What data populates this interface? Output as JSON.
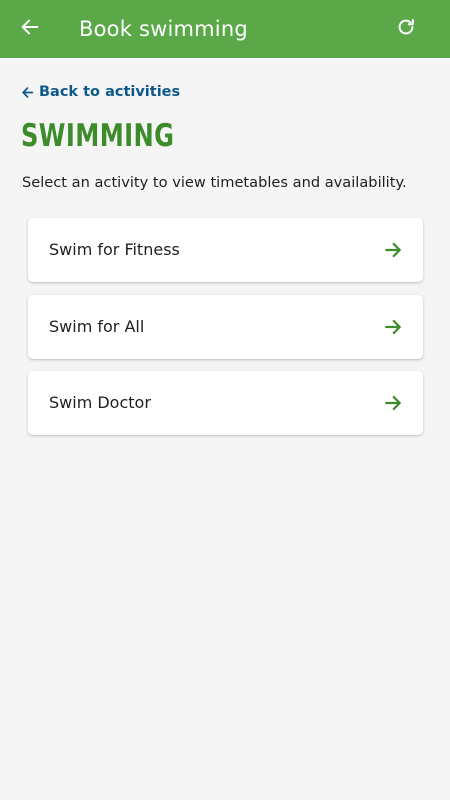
{
  "app_bar": {
    "title": "Book swimming",
    "back_icon": "arrow-left-icon",
    "refresh_icon": "refresh-icon",
    "color": "#5aa847"
  },
  "back_link": {
    "label": "Back to activities",
    "color": "#0d5a8a"
  },
  "page": {
    "heading": "SWIMMING",
    "heading_color": "#3c8c2a",
    "intro": "Select an activity to view timetables and availability."
  },
  "activities": [
    {
      "label": "Swim for Fitness",
      "icon": "arrow-right-icon"
    },
    {
      "label": "Swim for All",
      "icon": "arrow-right-icon"
    },
    {
      "label": "Swim Doctor",
      "icon": "arrow-right-icon"
    }
  ]
}
